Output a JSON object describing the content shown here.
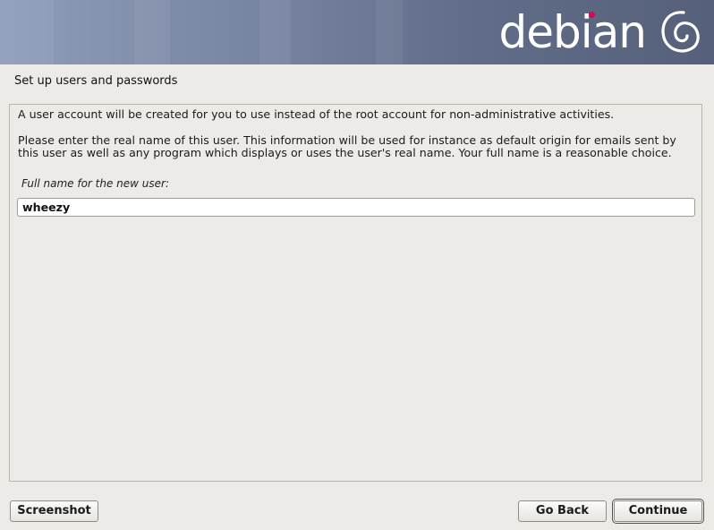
{
  "banner": {
    "logo_text": "debian",
    "logo_dot_color": "#d70751",
    "swirl_icon": "debian-swirl-icon"
  },
  "page": {
    "title": "Set up users and passwords"
  },
  "content": {
    "intro": "A user account will be created for you to use instead of the root account for non-administrative activities.",
    "description": "Please enter the real name of this user. This information will be used for instance as default origin for emails sent by this user as well as any program which displays or uses the user's real name. Your full name is a reasonable choice.",
    "field_label": "Full name for the new user:",
    "field_value": "wheezy"
  },
  "buttons": {
    "screenshot": "Screenshot",
    "go_back": "Go Back",
    "continue": "Continue"
  }
}
